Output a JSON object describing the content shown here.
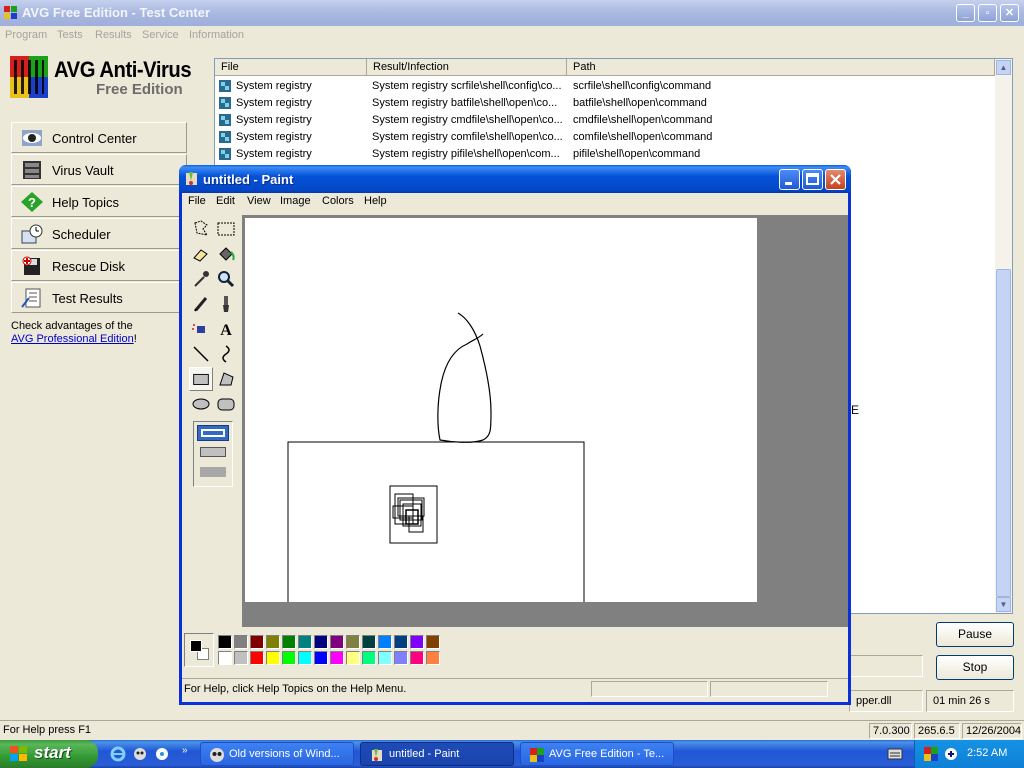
{
  "colors": {
    "xp_blue": "#0831d9",
    "avg_inactive_title": "#a9b8e0",
    "start_green": "#339933"
  },
  "avg": {
    "title": "AVG Free Edition - Test Center",
    "menu": [
      "Program",
      "Tests",
      "Results",
      "Service",
      "Information"
    ],
    "logo": {
      "line1": "AVG Anti-Virus",
      "line2": "Free Edition"
    },
    "nav": [
      {
        "label": "Control Center",
        "icon": "eye-icon"
      },
      {
        "label": "Virus Vault",
        "icon": "vault-icon"
      },
      {
        "label": "Help Topics",
        "icon": "help-icon"
      },
      {
        "label": "Scheduler",
        "icon": "clock-icon"
      },
      {
        "label": "Rescue Disk",
        "icon": "disk-icon"
      },
      {
        "label": "Test Results",
        "icon": "report-icon"
      }
    ],
    "advert": {
      "text": "Check advantages of the",
      "link": "AVG Professional Edition",
      "suffix": "!"
    },
    "columns": [
      "File",
      "Result/Infection",
      "Path"
    ],
    "rows": [
      {
        "file": "System registry",
        "result": "System registry scrfile\\shell\\config\\co...",
        "path": "scrfile\\shell\\config\\command"
      },
      {
        "file": "System registry",
        "result": "System registry batfile\\shell\\open\\co...",
        "path": "batfile\\shell\\open\\command"
      },
      {
        "file": "System registry",
        "result": "System registry cmdfile\\shell\\open\\co...",
        "path": "cmdfile\\shell\\open\\command"
      },
      {
        "file": "System registry",
        "result": "System registry comfile\\shell\\open\\co...",
        "path": "comfile\\shell\\open\\command"
      },
      {
        "file": "System registry",
        "result": "System registry pifile\\shell\\open\\com...",
        "path": "pifile\\shell\\open\\command"
      }
    ],
    "pause_label": "Pause",
    "stop_label": "Stop",
    "partial_e": "E",
    "current_file_fragment": "pper.dll",
    "elapsed": "01 min 26 s",
    "status": {
      "help": "For Help press F1",
      "version": "7.0.300",
      "db": "265.6.5",
      "date": "12/26/2004"
    }
  },
  "paint": {
    "title": "untitled - Paint",
    "menu": [
      "File",
      "Edit",
      "View",
      "Image",
      "Colors",
      "Help"
    ],
    "status": "For Help, click Help Topics on the Help Menu.",
    "tools": [
      "free-select-icon",
      "rect-select-icon",
      "eraser-icon",
      "fill-icon",
      "color-picker-icon",
      "magnifier-icon",
      "pencil-icon",
      "brush-icon",
      "airbrush-icon",
      "text-icon",
      "line-icon",
      "curve-icon",
      "rectangle-icon",
      "polygon-icon",
      "ellipse-icon",
      "rounded-rect-icon"
    ],
    "selected_tool": "rectangle-icon",
    "palette_top": [
      "#000000",
      "#808080",
      "#800000",
      "#808000",
      "#008000",
      "#008080",
      "#000080",
      "#800080",
      "#808040",
      "#004040",
      "#0080ff",
      "#004080",
      "#8000ff",
      "#804000"
    ],
    "palette_bottom": [
      "#ffffff",
      "#c0c0c0",
      "#ff0000",
      "#ffff00",
      "#00ff00",
      "#00ffff",
      "#0000ff",
      "#ff00ff",
      "#ffff80",
      "#00ff80",
      "#80ffff",
      "#8080ff",
      "#ff0080",
      "#ff8040"
    ]
  },
  "taskbar": {
    "start": "start",
    "tasks": [
      {
        "label": "Old versions of Wind...",
        "icon": "browser-icon"
      },
      {
        "label": "untitled - Paint",
        "icon": "paint-icon"
      },
      {
        "label": "AVG Free Edition - Te...",
        "icon": "avg-icon"
      }
    ],
    "clock": "2:52 AM"
  }
}
